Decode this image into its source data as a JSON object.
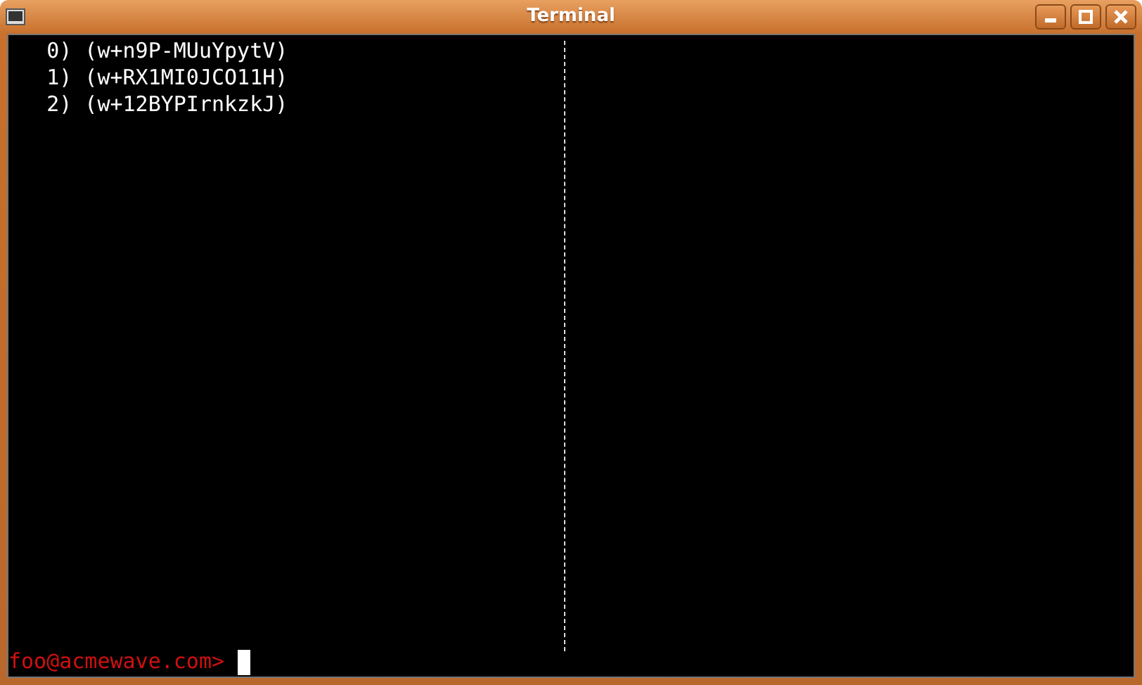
{
  "window": {
    "title": "Terminal"
  },
  "terminal": {
    "lines": [
      {
        "text": "   0) (w+n9P-MUuYpytV)"
      },
      {
        "text": "   1) (w+RX1MI0JCO11H)"
      },
      {
        "text": "   2) (w+12BYPIrnkzkJ)"
      }
    ],
    "prompt": "foo@acmewave.com>"
  }
}
